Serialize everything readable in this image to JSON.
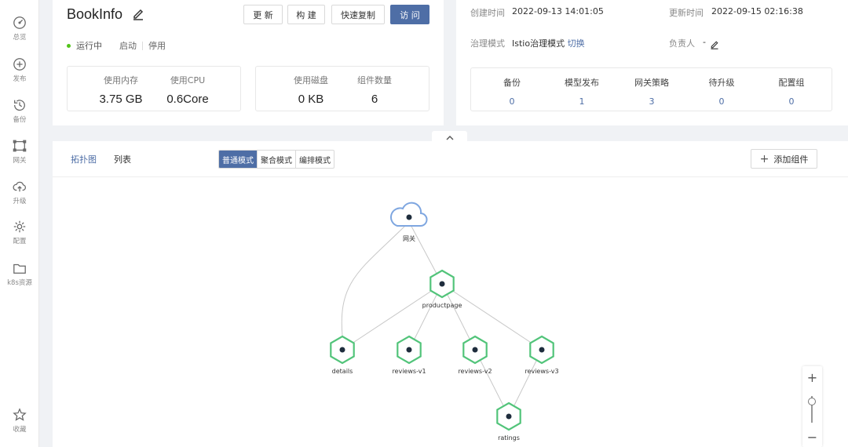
{
  "sidebar": {
    "items": [
      {
        "label": "总览",
        "icon": "dashboard-icon"
      },
      {
        "label": "发布",
        "icon": "publish-icon"
      },
      {
        "label": "备份",
        "icon": "history-icon"
      },
      {
        "label": "网关",
        "icon": "gateway-icon"
      },
      {
        "label": "升级",
        "icon": "cloud-upload-icon"
      },
      {
        "label": "配置",
        "icon": "gear-icon"
      },
      {
        "label": "k8s资源",
        "icon": "folder-icon"
      }
    ],
    "favorite": {
      "label": "收藏",
      "icon": "star-icon"
    }
  },
  "app": {
    "name": "BookInfo",
    "status": "运行中",
    "start_label": "启动",
    "stop_label": "停用"
  },
  "actions": {
    "update": "更 新",
    "build": "构 建",
    "quick_copy": "快速复制",
    "visit": "访 问"
  },
  "resources": {
    "memory_label": "使用内存",
    "memory_value": "3.75 GB",
    "cpu_label": "使用CPU",
    "cpu_value": "0.6Core",
    "disk_label": "使用磁盘",
    "disk_value": "0 KB",
    "components_label": "组件数量",
    "components_value": "6"
  },
  "info": {
    "created_label": "创建时间",
    "created_value": "2022-09-13 14:01:05",
    "updated_label": "更新时间",
    "updated_value": "2022-09-15 02:16:38",
    "governance_label": "治理模式",
    "governance_value": "Istio治理模式",
    "switch_label": "切换",
    "owner_label": "负责人",
    "owner_value": "-"
  },
  "stats": [
    {
      "label": "备份",
      "value": "0"
    },
    {
      "label": "模型发布",
      "value": "1"
    },
    {
      "label": "网关策略",
      "value": "3"
    },
    {
      "label": "待升级",
      "value": "0"
    },
    {
      "label": "配置组",
      "value": "0"
    }
  ],
  "view": {
    "tabs": [
      "拓扑图",
      "列表"
    ],
    "active_tab": "拓扑图",
    "modes": [
      "普通模式",
      "聚合模式",
      "编排模式"
    ],
    "active_mode": "普通模式",
    "add_component": "添加组件"
  },
  "topology": {
    "gateway": {
      "id": "gateway",
      "label": "网关"
    },
    "nodes": [
      {
        "id": "productpage",
        "label": "productpage"
      },
      {
        "id": "details",
        "label": "details"
      },
      {
        "id": "reviews-v1",
        "label": "reviews-v1"
      },
      {
        "id": "reviews-v2",
        "label": "reviews-v2"
      },
      {
        "id": "reviews-v3",
        "label": "reviews-v3"
      },
      {
        "id": "ratings",
        "label": "ratings"
      }
    ],
    "edges": [
      [
        "gateway",
        "productpage"
      ],
      [
        "gateway",
        "details"
      ],
      [
        "productpage",
        "details"
      ],
      [
        "productpage",
        "reviews-v1"
      ],
      [
        "productpage",
        "reviews-v2"
      ],
      [
        "productpage",
        "reviews-v3"
      ],
      [
        "reviews-v2",
        "ratings"
      ],
      [
        "reviews-v3",
        "ratings"
      ]
    ],
    "colors": {
      "gateway": "#7ea6e0",
      "service": "#52c47a",
      "edge": "#c8c8c8",
      "dot": "#1f2d3d"
    }
  },
  "zoom": {
    "zoom_in": "+",
    "zoom_out": "−",
    "level": 0.85
  }
}
